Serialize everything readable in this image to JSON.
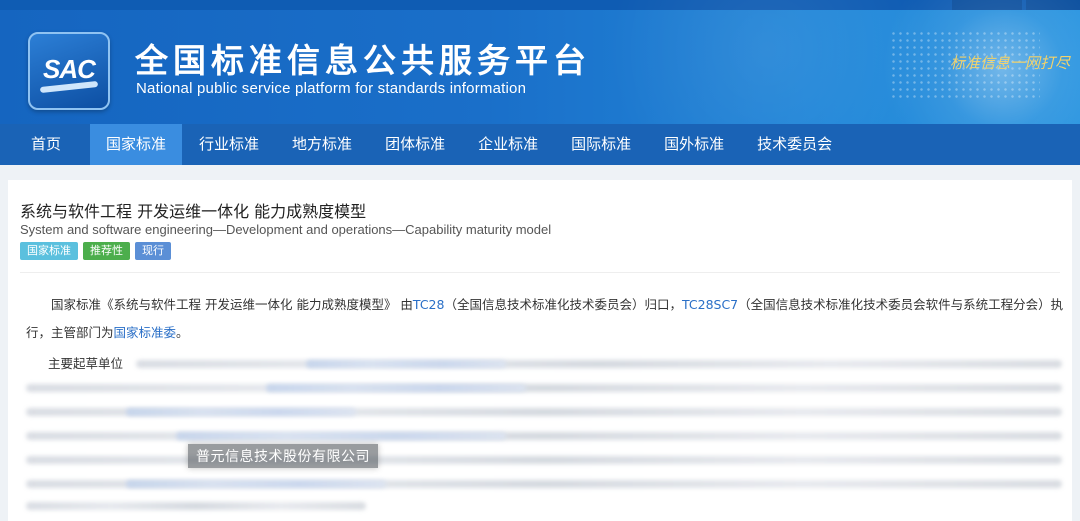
{
  "header": {
    "logo_text": "SAC",
    "title": "全国标准信息公共服务平台",
    "subtitle": "National public service platform  for standards information",
    "slogan": "标准信息一网打尽"
  },
  "nav": {
    "items": [
      {
        "label": "首页"
      },
      {
        "label": "国家标准",
        "active": true
      },
      {
        "label": "行业标准"
      },
      {
        "label": "地方标准"
      },
      {
        "label": "团体标准"
      },
      {
        "label": "企业标准"
      },
      {
        "label": "国际标准"
      },
      {
        "label": "国外标准"
      },
      {
        "label": "技术委员会"
      }
    ]
  },
  "standard": {
    "title_cn": "系统与软件工程 开发运维一体化 能力成熟度模型",
    "title_en": "System and software engineering—Development and operations—Capability maturity model",
    "tags": [
      "国家标准",
      "推荐性",
      "现行"
    ],
    "tag_colors": [
      "#5bc0de",
      "#4cae4c",
      "#5b8fd6"
    ]
  },
  "description": {
    "part1": "国家标准《系统与软件工程 开发运维一体化 能力成熟度模型》 由",
    "tc_link": "TC28",
    "part2": "（全国信息技术标准化技术委员会）归口，",
    "sc_link": "TC28SC7",
    "part3": "（全国信息技术标准化技术委员会软件与系统工程分会）执行，主管部门为",
    "dept_link": "国家标准委",
    "part4": "。"
  },
  "drafters": {
    "label": "主要起草单位",
    "highlight": "普元信息技术股份有限公司"
  }
}
